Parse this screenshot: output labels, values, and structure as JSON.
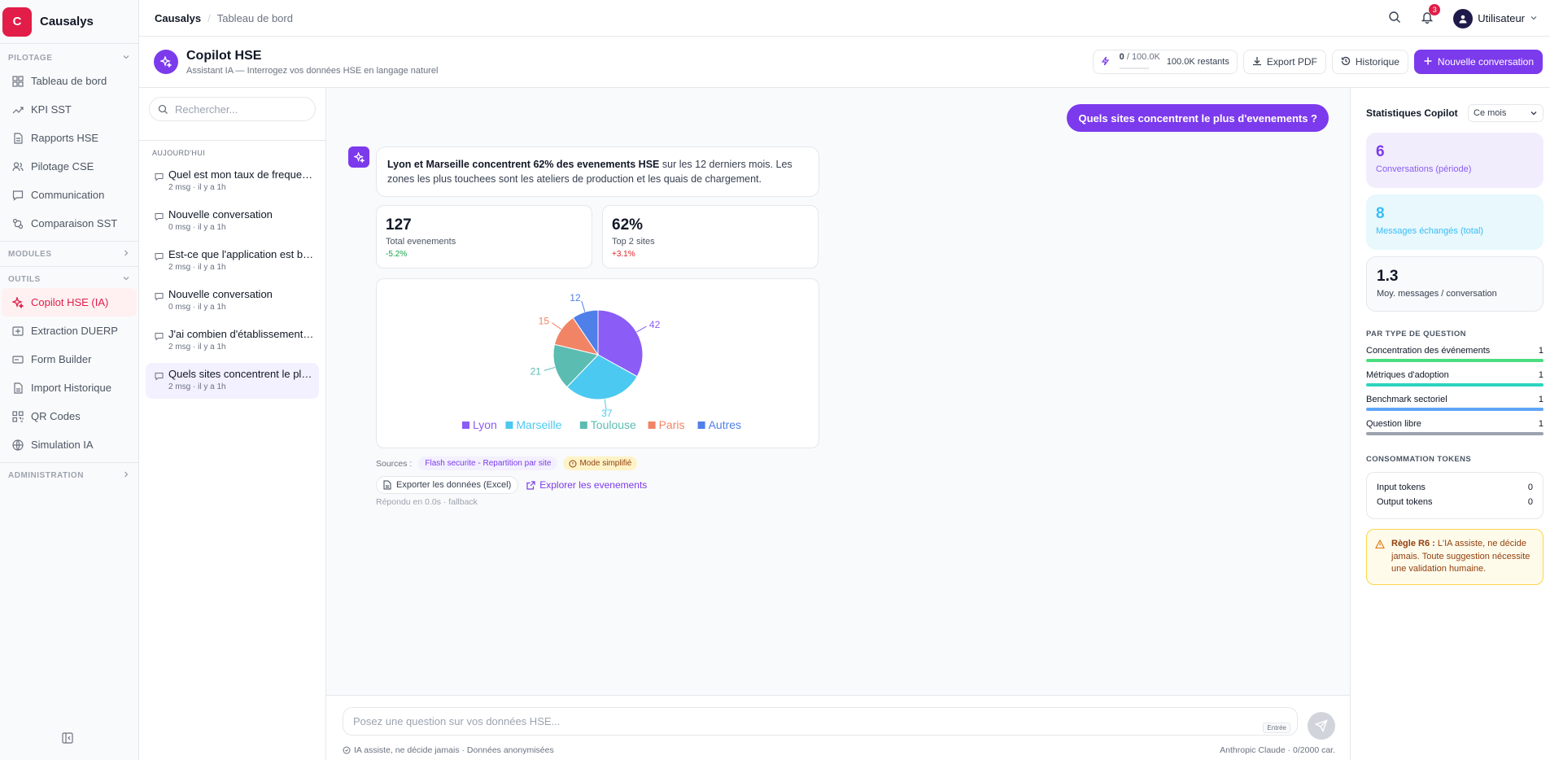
{
  "brand": {
    "logo_letter": "C",
    "name": "Causalys",
    "color": "#e11d48"
  },
  "sidebar": {
    "sections": [
      {
        "label": "PILOTAGE",
        "items": [
          {
            "label": "Tableau de bord",
            "icon": "dashboard-icon"
          },
          {
            "label": "KPI SST",
            "icon": "trend-icon"
          },
          {
            "label": "Rapports HSE",
            "icon": "document-icon"
          },
          {
            "label": "Pilotage CSE",
            "icon": "users-icon"
          },
          {
            "label": "Communication",
            "icon": "chat-icon"
          },
          {
            "label": "Comparaison SST",
            "icon": "compare-icon"
          }
        ]
      },
      {
        "label": "MODULES",
        "items": []
      },
      {
        "label": "OUTILS",
        "items": [
          {
            "label": "Copilot HSE (IA)",
            "icon": "sparkle-icon",
            "active": true
          },
          {
            "label": "Extraction DUERP",
            "icon": "upload-icon"
          },
          {
            "label": "Form Builder",
            "icon": "form-icon"
          },
          {
            "label": "Import Historique",
            "icon": "file-icon"
          },
          {
            "label": "QR Codes",
            "icon": "qr-icon"
          },
          {
            "label": "Simulation IA",
            "icon": "globe-icon"
          }
        ]
      },
      {
        "label": "ADMINISTRATION",
        "items": []
      }
    ]
  },
  "topbar": {
    "crumb_root": "Causalys",
    "crumb_current": "Tableau de bord",
    "notif_count": "3",
    "user_name": "Utilisateur"
  },
  "page": {
    "title": "Copilot HSE",
    "subtitle": "Assistant IA — Interrogez vos données HSE en langage naturel",
    "tokens_used": "0",
    "tokens_total": "/ 100.0K",
    "tokens_remaining": "100.0K restants",
    "export_label": "Export PDF",
    "history_label": "Historique",
    "new_label": "Nouvelle conversation"
  },
  "conversations": {
    "search_placeholder": "Rechercher...",
    "group_label": "AUJOURD'HUI",
    "items": [
      {
        "title": "Quel est mon taux de frequence ?",
        "meta": "2 msg · il y a 1h"
      },
      {
        "title": "Nouvelle conversation",
        "meta": "0 msg · il y a 1h"
      },
      {
        "title": "Est-ce que l'application est bien ?",
        "meta": "2 msg · il y a 1h"
      },
      {
        "title": "Nouvelle conversation",
        "meta": "0 msg · il y a 1h"
      },
      {
        "title": "J'ai combien d'établissements ?",
        "meta": "2 msg · il y a 1h"
      },
      {
        "title": "Quels sites concentrent le plus d'evenements ?",
        "meta": "2 msg · il y a 1h",
        "active": true
      }
    ]
  },
  "chat": {
    "question": "Quels sites concentrent le plus d'evenements ?",
    "answer_bold": "Lyon et Marseille concentrent 62% des evenements HSE",
    "answer_rest": " sur les 12 derniers mois. Les zones les plus touchees sont les ateliers de production et les quais de chargement.",
    "kpis": [
      {
        "value": "127",
        "label": "Total evenements",
        "delta": "-5.2%",
        "delta_color": "#16a34a"
      },
      {
        "value": "62%",
        "label": "Top 2 sites",
        "delta": "+3.1%",
        "delta_color": "#dc2626"
      }
    ],
    "sources_label": "Sources :",
    "source_tag": "Flash securite - Repartition par site",
    "mode_tag": "Mode simplifié",
    "export_button": "Exporter les données (Excel)",
    "explore_link": "Explorer les evenements",
    "meta": "Répondu en 0.0s · fallback",
    "input_placeholder": "Posez une question sur vos données HSE...",
    "kbd": "Entrée",
    "disclaimer": "IA assiste, ne décide jamais · Données anonymisées",
    "model_info": "Anthropic Claude · 0/2000 car."
  },
  "chart_data": {
    "type": "pie",
    "categories": [
      "Lyon",
      "Marseille",
      "Toulouse",
      "Paris",
      "Autres"
    ],
    "values": [
      42,
      37,
      21,
      15,
      12
    ],
    "colors": [
      "#8b5cf6",
      "#4cc9f0",
      "#5bbcb1",
      "#f28466",
      "#4f7fe8"
    ]
  },
  "stats": {
    "title": "Statistiques Copilot",
    "period": "Ce mois",
    "cards": [
      {
        "value": "6",
        "label": "Conversations (période)",
        "bg": "#f1edfd",
        "color": "#7c3aed"
      },
      {
        "value": "8",
        "label": "Messages échangés (total)",
        "bg": "#e8f8fd",
        "color": "#38bdf8"
      },
      {
        "value": "1.3",
        "label": "Moy. messages / conversation",
        "bg": "#f9fafb",
        "color": "#111827"
      }
    ],
    "qtype_title": "PAR TYPE DE QUESTION",
    "qtypes": [
      {
        "label": "Concentration des événements",
        "count": "1",
        "color": "#4ade80"
      },
      {
        "label": "Métriques d'adoption",
        "count": "1",
        "color": "#2dd4bf"
      },
      {
        "label": "Benchmark sectoriel",
        "count": "1",
        "color": "#60a5fa"
      },
      {
        "label": "Question libre",
        "count": "1",
        "color": "#9ca3af"
      }
    ],
    "tokens_title": "CONSOMMATION TOKENS",
    "input_tokens_label": "Input tokens",
    "input_tokens": "0",
    "output_tokens_label": "Output tokens",
    "output_tokens": "0",
    "rule_bold": "Règle R6 :",
    "rule_text": " L'IA assiste, ne décide jamais. Toute suggestion nécessite une validation humaine."
  }
}
